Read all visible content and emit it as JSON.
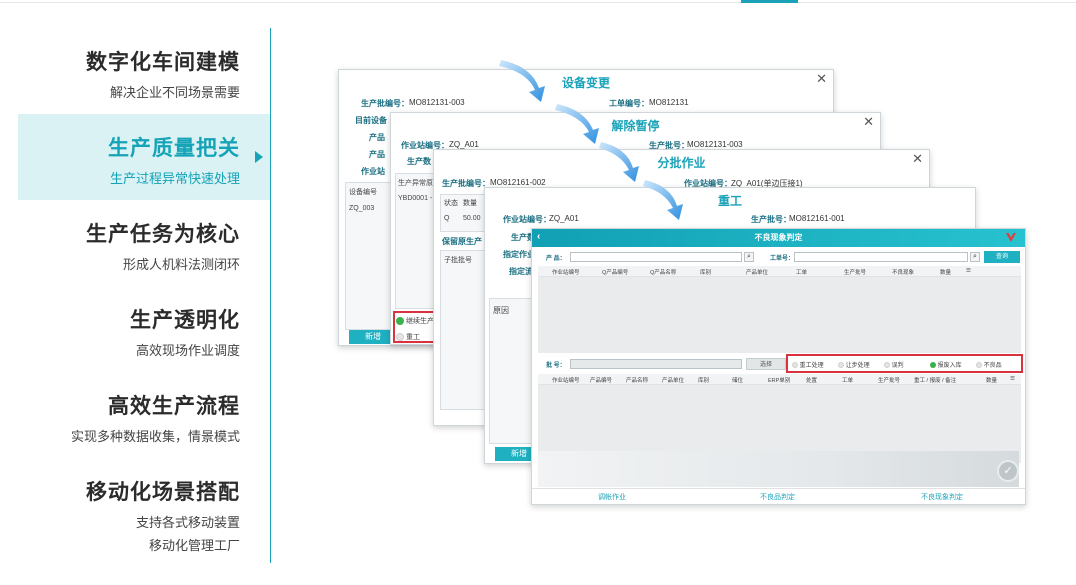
{
  "menu": [
    {
      "title": "数字化车间建模",
      "sub": "解决企业不同场景需要"
    },
    {
      "title": "生产质量把关",
      "sub": "生产过程异常快速处理"
    },
    {
      "title": "生产任务为核心",
      "sub": "形成人机料法测闭环"
    },
    {
      "title": "生产透明化",
      "sub": "高效现场作业调度"
    },
    {
      "title": "高效生产流程",
      "sub": "实现多种数据收集，情景模式"
    },
    {
      "title": "移动化场景搭配",
      "sub": "支持各式移动装置",
      "sub2": "移动化管理工厂"
    }
  ],
  "active_index": 1,
  "accent": "#1aa3b8",
  "win1": {
    "title": "设备变更",
    "lot_label": "生产批编号：",
    "lot_value": "MO812131-003",
    "order_label": "工单编号：",
    "order_value": "MO812131",
    "l1": "目前设备",
    "l2": "产品",
    "l3": "产品",
    "l4": "作业站",
    "col1": "设备编号",
    "row1": "ZQ_003",
    "btn": "新增"
  },
  "win2": {
    "title": "解除暂停",
    "station_label": "作业站编号：",
    "station_value": "ZQ_A01",
    "lot_label": "生产批号：",
    "lot_value": "MO812131-003",
    "l1": "生产数",
    "sec": "生产异常原",
    "row1": "YBD0001 - F",
    "opt1": "继续生产",
    "opt2": "重工"
  },
  "win3": {
    "title": "分批作业",
    "lot_label": "生产批编号：",
    "lot_value": "MO812161-002",
    "station_label": "作业站编号：",
    "station_value": "ZQ_A01(单边压接1)",
    "col1": "状态",
    "col2": "数量",
    "row_state": "Q",
    "row_qty": "50.00",
    "keep": "保留原生产",
    "sub_lot": "子批批号"
  },
  "win4": {
    "title": "重工",
    "station_label": "作业站编号：",
    "station_value": "ZQ_A01",
    "lot_label": "生产批号：",
    "lot_value": "MO812161-001",
    "l1": "生产数",
    "l2": "指定作业",
    "l3": "指定流",
    "reason": "原因",
    "btn": "新增"
  },
  "front": {
    "title": "不良现象判定",
    "product_label": "产 品：",
    "order_label": "工单号：",
    "query_btn": "查询",
    "grid1_cols": [
      "作业站编号",
      "Q产品编号",
      "Q产品名称",
      "库别",
      "产品单位",
      "工单",
      "生产批号",
      "不良现象",
      "数量"
    ],
    "batch_label": "批 号：",
    "select_btn": "选择",
    "options": [
      "重工处理",
      "让步处理",
      "误判",
      "报废入库",
      "不良品"
    ],
    "grid2_cols": [
      "作业站编号",
      "产品编号",
      "产品名称",
      "产品单位",
      "库别",
      "储位",
      "ERP单别",
      "处置",
      "工单",
      "生产批号",
      "重工 / 报废 / 备注",
      "数量"
    ],
    "tabs": [
      "调帐作业",
      "不良品判定",
      "不良现象判定"
    ]
  }
}
